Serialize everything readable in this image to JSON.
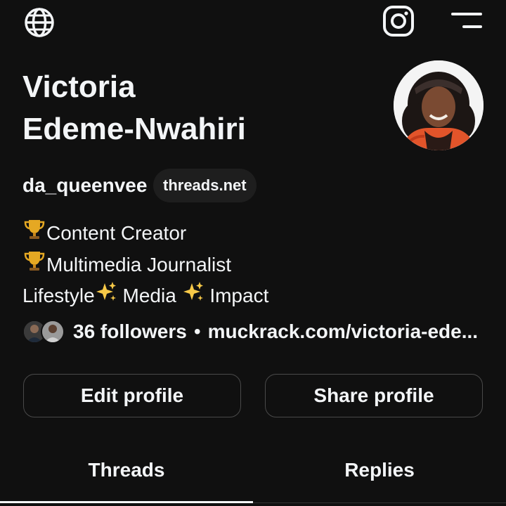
{
  "header": {
    "globe_icon": "globe-icon",
    "instagram_icon": "instagram-icon",
    "menu_icon": "menu-icon"
  },
  "profile": {
    "name_line_1": "Victoria",
    "name_line_2": "Edeme-Nwahiri",
    "username": "da_queenvee",
    "domain_badge": "threads.net",
    "bio": [
      {
        "prefix_icon": "trophy-emoji",
        "text": "Content Creator"
      },
      {
        "prefix_icon": "trophy-emoji",
        "text": "Multimedia Journalist"
      },
      {
        "parts": [
          "Lifestyle",
          "sparkles-emoji",
          " Media ",
          "sparkles-emoji",
          " Impact"
        ]
      }
    ],
    "bio_line_1": "Content Creator",
    "bio_line_2": "Multimedia Journalist",
    "bio_line_3_a": "Lifestyle",
    "bio_line_3_b": " Media ",
    "bio_line_3_c": " Impact",
    "followers": "36 followers",
    "separator": "•",
    "link": "muckrack.com/victoria-ede..."
  },
  "actions": {
    "edit_label": "Edit profile",
    "share_label": "Share profile"
  },
  "tabs": [
    {
      "label": "Threads",
      "active": true
    },
    {
      "label": "Replies",
      "active": false
    }
  ],
  "tabs_threads": "Threads",
  "tabs_replies": "Replies",
  "colors": {
    "background": "#101010",
    "text": "#f3f5f7",
    "pill_bg": "#1e1e1e",
    "button_border": "#4a4a4a",
    "trophy": "#e5a823",
    "sparkle": "#f7c948"
  }
}
